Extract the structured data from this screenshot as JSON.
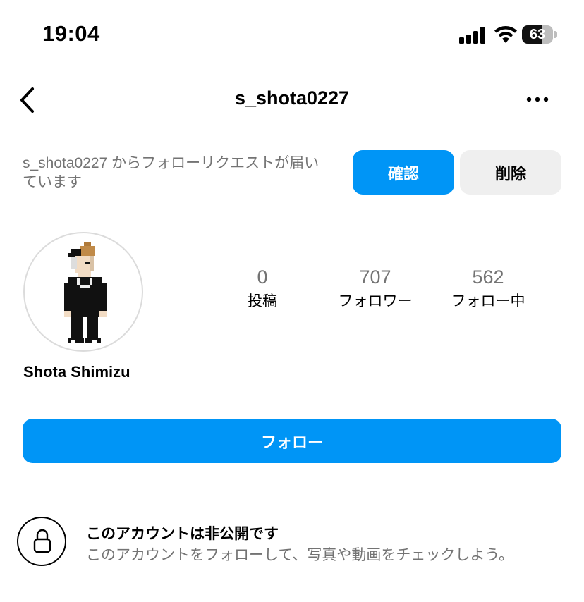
{
  "status_bar": {
    "time": "19:04",
    "battery": "63",
    "battery_level": 0.63
  },
  "header": {
    "username": "s_shota0227",
    "back_icon": "chevron-left-icon",
    "more_icon": "more-horizontal-icon"
  },
  "follow_request": {
    "text": "s_shota0227 からフォローリクエストが届いています",
    "confirm_label": "確認",
    "delete_label": "削除"
  },
  "profile": {
    "full_name": "Shota Shimizu",
    "stats": [
      {
        "value": "0",
        "label": "投稿"
      },
      {
        "value": "707",
        "label": "フォロワー"
      },
      {
        "value": "562",
        "label": "フォロー中"
      }
    ],
    "follow_label": "フォロー"
  },
  "private_notice": {
    "title": "このアカウントは非公開です",
    "description": "このアカウントをフォローして、写真や動画をチェックしよう。"
  },
  "colors": {
    "accent": "#0095f6",
    "secondary_button": "#efefef",
    "muted_text": "#737373"
  }
}
